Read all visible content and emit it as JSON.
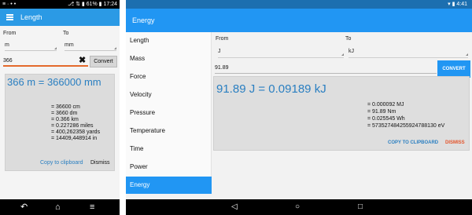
{
  "phone": {
    "status": {
      "left": "≡ · • •",
      "right": "⎇ ⇅ ▮ 61% ▮ 17:24"
    },
    "title": "Length",
    "from_label": "From",
    "to_label": "To",
    "from_value": "m",
    "to_value": "mm",
    "input_value": "366",
    "clear_glyph": "✖",
    "convert_label": "Convert",
    "result_main": "366 m = 366000 mm",
    "results": [
      "= 36600 cm",
      "= 3660 dm",
      "= 0.366 km",
      "= 0.227286 miles",
      "= 400,262358 yards",
      "= 14409,448914 in"
    ],
    "copy_label": "Copy to clipboard",
    "dismiss_label": "Dismiss",
    "nav": {
      "back": "↶",
      "home": "⌂",
      "recents": "≡"
    }
  },
  "tablet": {
    "status": {
      "right": "▾ ▮ 4:41"
    },
    "title": "Energy",
    "sidebar": [
      "Length",
      "Mass",
      "Force",
      "Velocity",
      "Pressure",
      "Temperature",
      "Time",
      "Power",
      "Energy"
    ],
    "active_item": "Energy",
    "from_label": "From",
    "to_label": "To",
    "from_value": "J",
    "to_value": "kJ",
    "input_value": "91.89",
    "convert_label": "CONVERT",
    "result_main": "91.89 J = 0.09189 kJ",
    "results": [
      "= 0.000092 MJ",
      "= 91.89 Nm",
      "= 0.025545 Wh",
      "= 5735274842559247881​30 eV"
    ],
    "copy_label": "COPY TO CLIPBOARD",
    "dismiss_label": "DISMISS",
    "nav": {
      "back": "◁",
      "home": "○",
      "recents": "□"
    }
  },
  "colors": {
    "accent": "#2196f3",
    "result_text": "#2a7fc1",
    "dismiss": "#e4552c",
    "input_underline": "#e46a2c"
  }
}
